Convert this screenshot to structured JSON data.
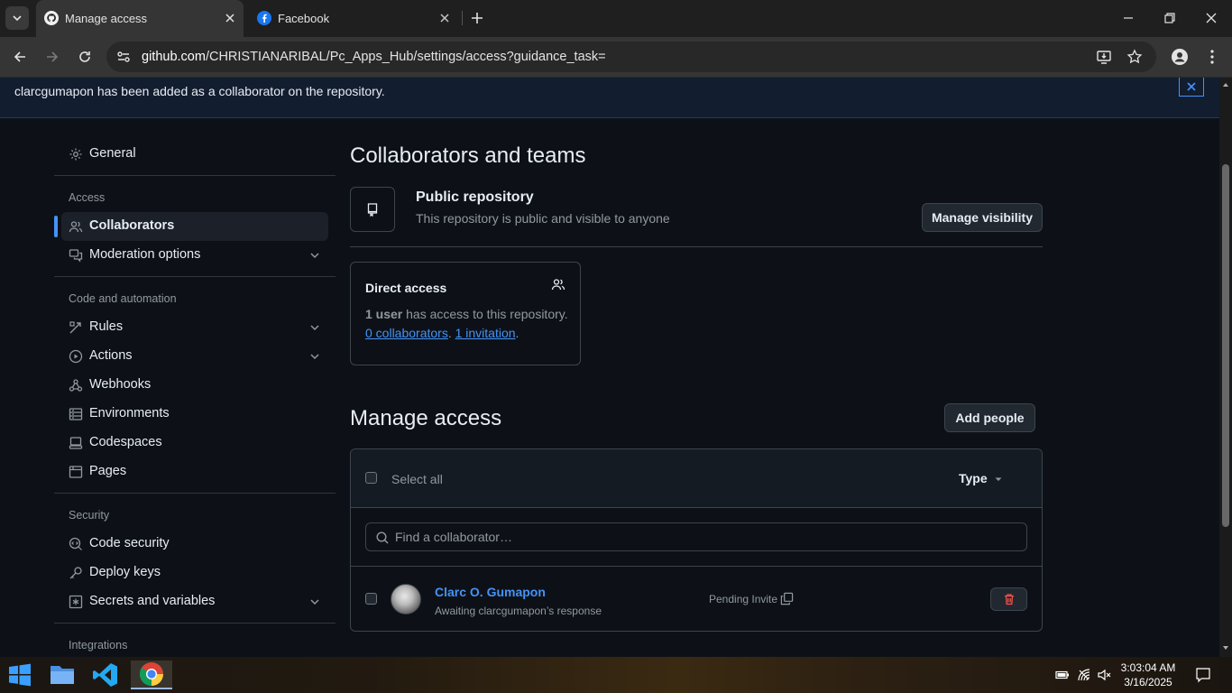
{
  "browser": {
    "tabs": [
      {
        "title": "Manage access",
        "active": true,
        "icon": "github-icon"
      },
      {
        "title": "Facebook",
        "active": false,
        "icon": "facebook-icon"
      }
    ],
    "url_host": "github.com",
    "url_path": "/CHRISTIANARIBAL/Pc_Apps_Hub/settings/access?guidance_task="
  },
  "flash": {
    "message": "clarcgumapon has been added as a collaborator on the repository."
  },
  "sidebar": {
    "general": "General",
    "sections": [
      {
        "heading": "Access"
      },
      {
        "heading": "Code and automation"
      },
      {
        "heading": "Security"
      },
      {
        "heading": "Integrations"
      }
    ],
    "items": {
      "collaborators": "Collaborators",
      "moderation": "Moderation options",
      "rules": "Rules",
      "actions": "Actions",
      "webhooks": "Webhooks",
      "environments": "Environments",
      "codespaces": "Codespaces",
      "pages": "Pages",
      "code_security": "Code security",
      "deploy_keys": "Deploy keys",
      "secrets": "Secrets and variables"
    }
  },
  "main": {
    "title": "Collaborators and teams",
    "public_repo": {
      "title": "Public repository",
      "subtitle": "This repository is public and visible to anyone",
      "button": "Manage visibility"
    },
    "direct_access": {
      "title": "Direct access",
      "count": "1 user",
      "text": " has access to this repository.",
      "collaborators_link": "0 collaborators",
      "sep": ". ",
      "invitation_link": "1 invitation",
      "end": "."
    },
    "manage_access": {
      "title": "Manage access",
      "add_button": "Add people",
      "select_all": "Select all",
      "type_filter": "Type",
      "search_placeholder": "Find a collaborator…",
      "members": [
        {
          "name": "Clarc O. Gumapon",
          "status": "Awaiting clarcgumapon’s response",
          "role": "Pending Invite"
        }
      ]
    }
  },
  "taskbar": {
    "time": "3:03:04 AM",
    "date": "3/16/2025"
  }
}
